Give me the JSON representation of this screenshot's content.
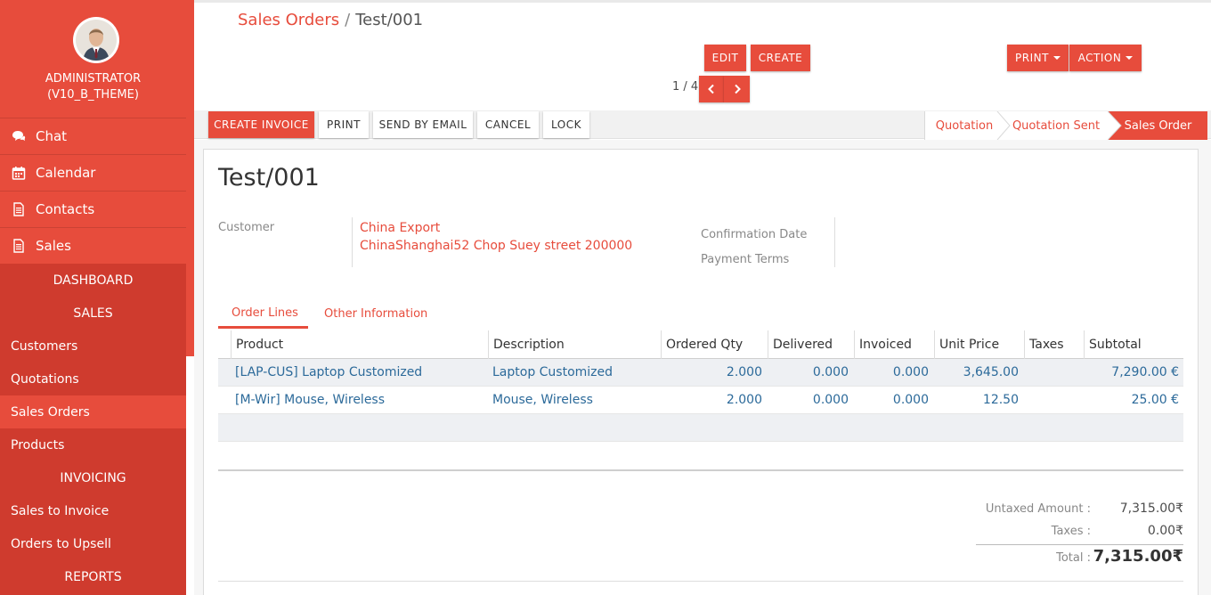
{
  "user": {
    "name_line1": "ADMINISTRATOR",
    "name_line2": "(V10_B_THEME)"
  },
  "sidebar": {
    "apps": [
      {
        "label": "Chat",
        "icon": "chat-icon"
      },
      {
        "label": "Calendar",
        "icon": "calendar-icon"
      },
      {
        "label": "Contacts",
        "icon": "contacts-icon"
      },
      {
        "label": "Sales",
        "icon": "sales-icon"
      }
    ],
    "sub": {
      "dashboard": "DASHBOARD",
      "sales_header": "SALES",
      "customers": "Customers",
      "quotations": "Quotations",
      "sales_orders": "Sales Orders",
      "products": "Products",
      "invoicing_header": "INVOICING",
      "sales_to_invoice": "Sales to Invoice",
      "orders_to_upsell": "Orders to Upsell",
      "reports_header": "REPORTS"
    }
  },
  "breadcrumb": {
    "parent": "Sales Orders",
    "separator": "/",
    "current": "Test/001"
  },
  "buttons": {
    "edit": "EDIT",
    "create": "CREATE",
    "print": "PRINT",
    "action": "ACTION"
  },
  "pager": {
    "value": "1 / 4"
  },
  "statusbar": {
    "create_invoice": "CREATE INVOICE",
    "print": "PRINT",
    "send_by_email": "SEND BY EMAIL",
    "cancel": "CANCEL",
    "lock": "LOCK",
    "stages": [
      "Quotation",
      "Quotation Sent",
      "Sales Order"
    ]
  },
  "form": {
    "title": "Test/001",
    "customer_label": "Customer",
    "customer_name": "China Export",
    "customer_address": "ChinaShanghai52 Chop Suey street 200000",
    "confirmation_date_label": "Confirmation Date",
    "payment_terms_label": "Payment Terms"
  },
  "tabs": {
    "order_lines": "Order Lines",
    "other_information": "Other Information"
  },
  "table": {
    "headers": [
      "Product",
      "Description",
      "Ordered Qty",
      "Delivered",
      "Invoiced",
      "Unit Price",
      "Taxes",
      "Subtotal"
    ],
    "rows": [
      [
        "[LAP-CUS] Laptop Customized",
        "Laptop Customized",
        "2.000",
        "0.000",
        "0.000",
        "3,645.00",
        "",
        "7,290.00 €"
      ],
      [
        "[M-Wir] Mouse, Wireless",
        "Mouse, Wireless",
        "2.000",
        "0.000",
        "0.000",
        "12.50",
        "",
        "25.00 €"
      ]
    ]
  },
  "totals": {
    "untaxed_label": "Untaxed Amount :",
    "untaxed_value": "7,315.00₹",
    "taxes_label": "Taxes :",
    "taxes_value": "0.00₹",
    "total_label": "Total :",
    "total_value": "7,315.00₹"
  },
  "colors": {
    "accent": "#e74c3c",
    "accent_dark": "#cf3b2e",
    "link_blue": "#2c6a9a"
  }
}
